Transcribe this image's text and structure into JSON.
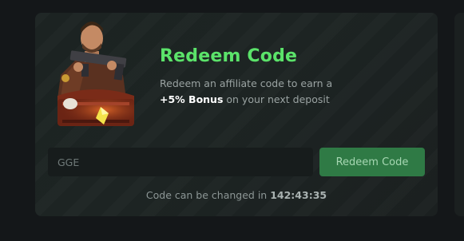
{
  "redeem": {
    "title": "Redeem Code",
    "description_prefix": "Redeem an affiliate code to earn a",
    "bonus": "+5% Bonus",
    "description_suffix": "on your next deposit",
    "input_value": "GGE",
    "button_label": "Redeem Code",
    "cooldown_prefix": "Code can be changed in",
    "cooldown_time": "142:43:35",
    "illustration": "soldier-with-treasure-chest-icon"
  },
  "colors": {
    "title": "#5be36a",
    "button_bg": "#2f7a45",
    "card_bg": "#1c2322",
    "page_bg": "#141719"
  }
}
